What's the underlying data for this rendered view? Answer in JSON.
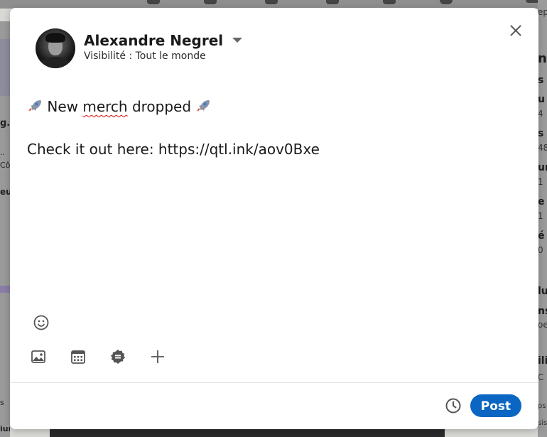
{
  "background": {
    "left_texts": [
      "g..",
      "..",
      "Côt",
      "eux",
      "s",
      "ium"
    ],
    "right_texts": [
      "n",
      "s a",
      "u g",
      "4",
      "s l",
      "48",
      "ur",
      "1",
      "e c",
      "1",
      "é",
      "0",
      "lu",
      "ns",
      "oe",
      "ili",
      "C",
      "ps",
      "sis"
    ],
    "top_right_text": "ep"
  },
  "composer": {
    "author_name": "Alexandre Negrel",
    "visibility": "Visibilité : Tout le monde",
    "post_text": {
      "line1_before": "New ",
      "line1_misspelled": "merch",
      "line1_after": " dropped",
      "line2": "Check it out here: https://qtl.ink/aov0Bxe"
    },
    "post_button": "Post"
  },
  "icons": {
    "close": "close-icon",
    "emoji": "emoji-smile-icon",
    "photo": "image-icon",
    "event": "calendar-icon",
    "celebrate": "badge-icon",
    "more": "plus-icon",
    "schedule": "clock-icon",
    "rocket": "rocket-icon"
  },
  "colors": {
    "accent": "#0a66c2",
    "overlay": "#8e8e8e",
    "icon": "#555555"
  }
}
